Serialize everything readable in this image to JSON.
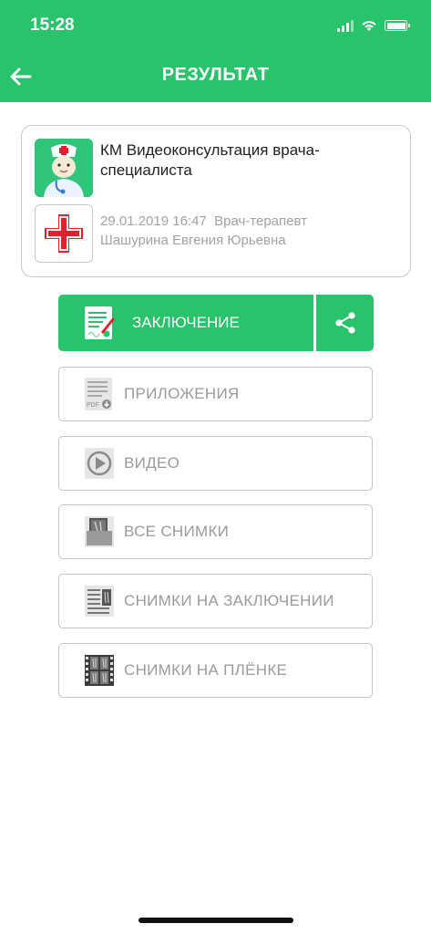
{
  "status_bar": {
    "time": "15:28"
  },
  "header": {
    "title": "РЕЗУЛЬТАТ",
    "back_icon": "arrow-left-icon"
  },
  "consultation": {
    "title": "КМ Видеоконсультация врача-специалиста",
    "date_time": "29.01.2019 16:47",
    "doctor_role": "Врач-терапевт",
    "doctor_name": "Шашурина Евгения Юрьевна"
  },
  "actions": {
    "conclusion_label": "ЗАКЛЮЧЕНИЕ",
    "attachments_label": "ПРИЛОЖЕНИЯ",
    "video_label": "ВИДЕО",
    "all_images_label": "ВСЕ СНИМКИ",
    "images_in_conclusion_label": "СНИМКИ НА ЗАКЛЮЧЕНИИ",
    "images_on_film_label": "СНИМКИ НА ПЛЁНКЕ",
    "pdf_label": "PDF"
  },
  "colors": {
    "accent": "#28c36a",
    "muted_text": "#9b9b9b",
    "border": "#c4c4c4",
    "logo_red": "#e0212b"
  }
}
